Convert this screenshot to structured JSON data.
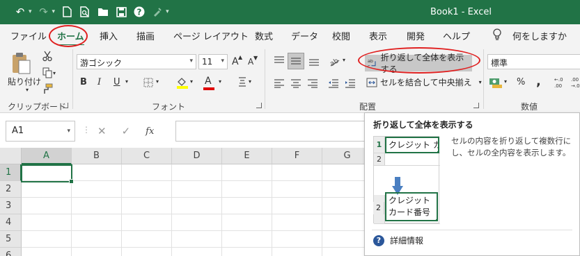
{
  "colors": {
    "accent": "#217346",
    "annotation": "#e02020",
    "help": "#2b579a"
  },
  "titlebar": {
    "title": "Book1 - Excel",
    "qat": [
      "undo-icon",
      "redo-icon",
      "new-file-icon",
      "print-preview-icon",
      "open-folder-icon",
      "save-icon",
      "help-icon",
      "format-painter-icon",
      "customize-qat-icon"
    ]
  },
  "tabs": [
    "ファイル",
    "ホーム",
    "挿入",
    "描画",
    "ページ レイアウト",
    "数式",
    "データ",
    "校閲",
    "表示",
    "開発",
    "ヘルプ"
  ],
  "active_tab": "ホーム",
  "tell_me": "何をしますか",
  "ribbon": {
    "clipboard": {
      "paste": "貼り付け",
      "label": "クリップボード"
    },
    "font": {
      "name": "游ゴシック",
      "size": "11",
      "grow": "A",
      "shrink": "A",
      "bold": "B",
      "italic": "I",
      "underline": "U",
      "font_color_letter": "A",
      "label": "フォント"
    },
    "alignment": {
      "wrap_text": "折り返して全体を表示する",
      "merge": "セルを結合して中央揃え",
      "label": "配置"
    },
    "number": {
      "format": "標準",
      "percent": "%",
      "comma": ",",
      "label": "数値"
    }
  },
  "formula_bar": {
    "name_box": "A1",
    "fx": "fx"
  },
  "grid": {
    "columns": [
      "A",
      "B",
      "C",
      "D",
      "E",
      "F",
      "G"
    ],
    "rows": [
      "1",
      "2",
      "3",
      "4",
      "5",
      "6"
    ],
    "active_cell": "A1"
  },
  "tooltip": {
    "title": "折り返して全体を表示する",
    "description": "セルの内容を折り返して複数行にし、セルの全内容を表示します。",
    "example_before": "クレジット カ",
    "example_after_line1": "クレジット",
    "example_after_line2": "カード番号",
    "row1": "1",
    "row2": "2",
    "help_link": "詳細情報"
  }
}
